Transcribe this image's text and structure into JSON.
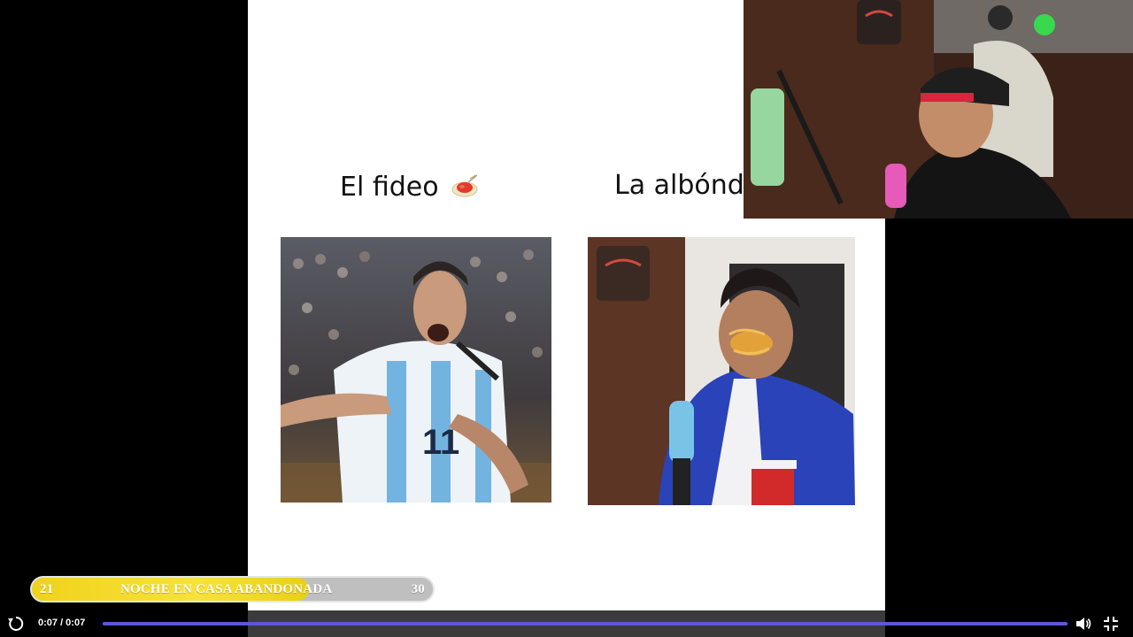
{
  "slide": {
    "caption_left": "El fideo",
    "caption_right": "La albónd",
    "emoji_left": "spaghetti-icon"
  },
  "photos": {
    "left": "soccer-player-photo",
    "right": "streamer-eating-spaghetti-photo"
  },
  "webcam": "streamer-webcam",
  "progress_pill": {
    "start": "21",
    "title": "NOCHE EN CASA ABANDONADA",
    "end": "30",
    "fill_fraction": 0.69,
    "fill_color": "#f7e23a"
  },
  "player": {
    "time": "0:07 / 0:07",
    "progress_fraction": 1.0,
    "accent": "#5b57d8",
    "icons": [
      "replay-icon",
      "volume-icon",
      "exit-fullscreen-icon"
    ]
  }
}
